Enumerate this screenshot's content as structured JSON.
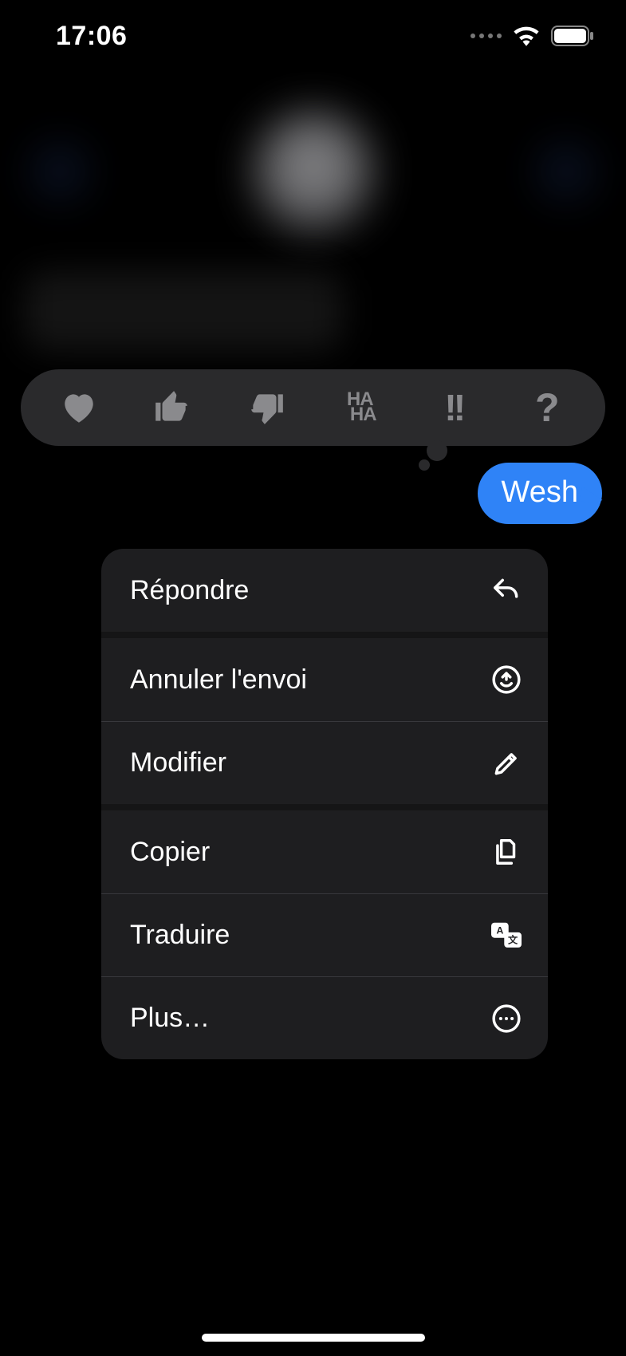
{
  "status": {
    "time": "17:06"
  },
  "message": {
    "sent_text": "Wesh"
  },
  "tapbacks": {
    "heart": "heart",
    "thumbs_up": "thumbs-up",
    "thumbs_down": "thumbs-down",
    "haha": "HA HA",
    "exclaim": "!!",
    "question": "?"
  },
  "menu": {
    "reply": "Répondre",
    "undo_send": "Annuler l'envoi",
    "edit": "Modifier",
    "copy": "Copier",
    "translate": "Traduire",
    "more": "Plus…"
  }
}
